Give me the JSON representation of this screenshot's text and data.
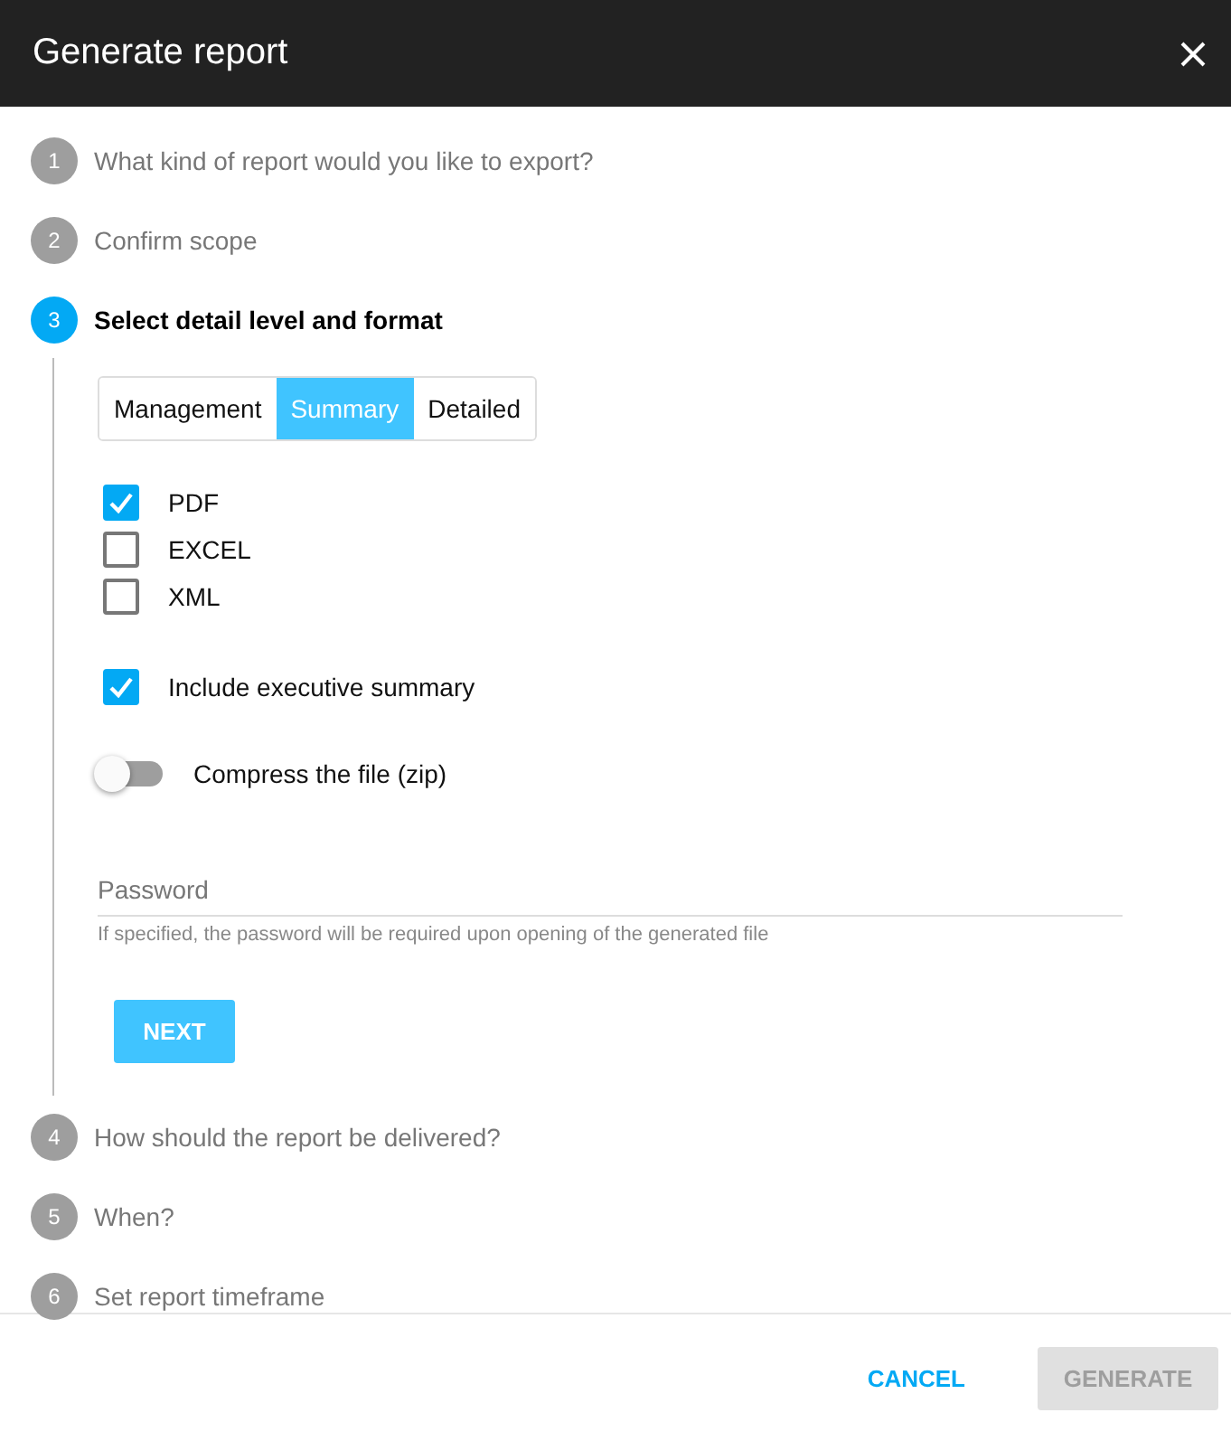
{
  "window": {
    "title": "Generate report"
  },
  "steps": [
    {
      "number": "1",
      "label": "What kind of report would you like to export?",
      "selected": false
    },
    {
      "number": "2",
      "label": "Confirm scope",
      "selected": false
    },
    {
      "number": "3",
      "label": "Select detail level and format",
      "selected": true
    },
    {
      "number": "4",
      "label": "How should the report be delivered?",
      "selected": false
    },
    {
      "number": "5",
      "label": "When?",
      "selected": false
    },
    {
      "number": "6",
      "label": "Set report timeframe",
      "selected": false
    }
  ],
  "detail_levels": [
    {
      "label": "Management",
      "selected": false
    },
    {
      "label": "Summary",
      "selected": true
    },
    {
      "label": "Detailed",
      "selected": false
    }
  ],
  "formats": [
    {
      "label": "PDF",
      "checked": true
    },
    {
      "label": "EXCEL",
      "checked": false
    },
    {
      "label": "XML",
      "checked": false
    }
  ],
  "executive_summary": {
    "label": "Include executive summary",
    "checked": true
  },
  "compress": {
    "label": "Compress the file (zip)",
    "on": false
  },
  "password": {
    "placeholder": "Password",
    "hint": "If specified, the password will be required upon opening of the generated file"
  },
  "next_button": "NEXT",
  "footer": {
    "cancel": "CANCEL",
    "generate": {
      "label": "GENERATE",
      "disabled": true
    }
  }
}
